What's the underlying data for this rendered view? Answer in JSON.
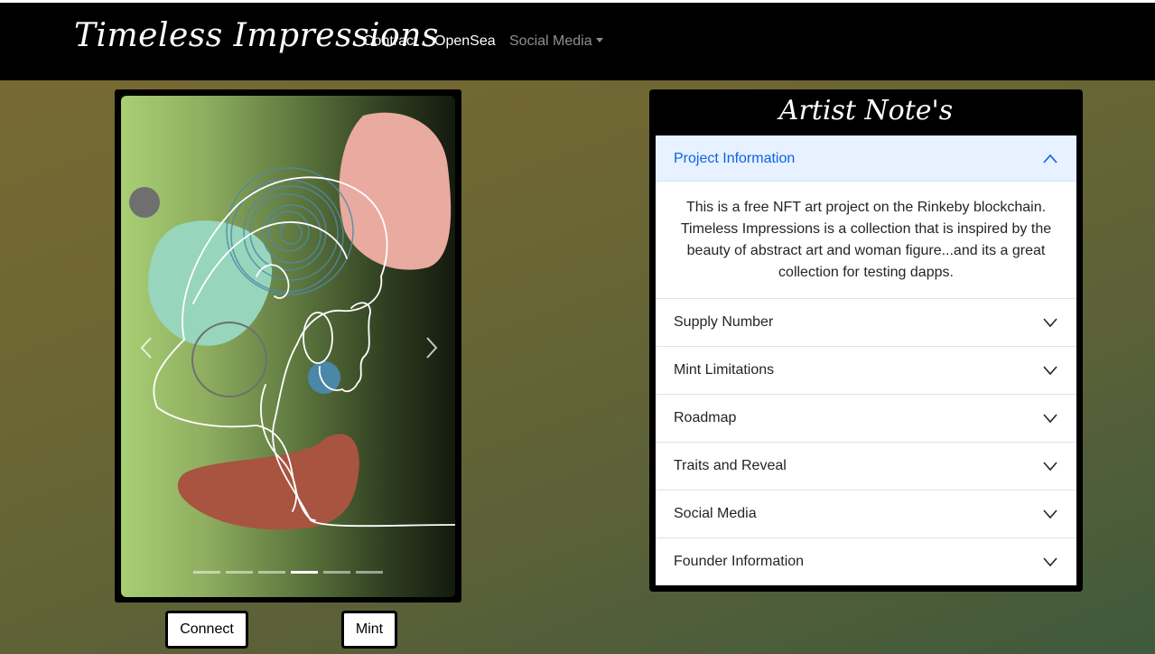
{
  "navbar": {
    "brand": "Timeless Impressions",
    "links": [
      {
        "label": "Contract"
      },
      {
        "label": "OpenSea"
      },
      {
        "label": "Social Media"
      }
    ]
  },
  "carousel": {
    "slide_count": 6,
    "active_slide": 4
  },
  "buttons": {
    "connect_label": "Connect",
    "mint_label": "Mint"
  },
  "notes": {
    "title": "Artist Note's",
    "items": [
      {
        "label": "Project Information",
        "expanded": true,
        "body": "This is a free NFT art project on the Rinkeby blockchain. Timeless Impressions is a collection that is inspired by the beauty of abstract art and woman figure...and its a great collection for testing dapps."
      },
      {
        "label": "Supply Number",
        "expanded": false
      },
      {
        "label": "Mint Limitations",
        "expanded": false
      },
      {
        "label": "Roadmap",
        "expanded": false
      },
      {
        "label": "Traits and Reveal",
        "expanded": false
      },
      {
        "label": "Social Media",
        "expanded": false
      },
      {
        "label": "Founder Information",
        "expanded": false
      }
    ]
  },
  "colors": {
    "navbar_bg": "#000000",
    "accordion_active_bg": "#e7f1ff",
    "accordion_active_text": "#0c63e4"
  }
}
